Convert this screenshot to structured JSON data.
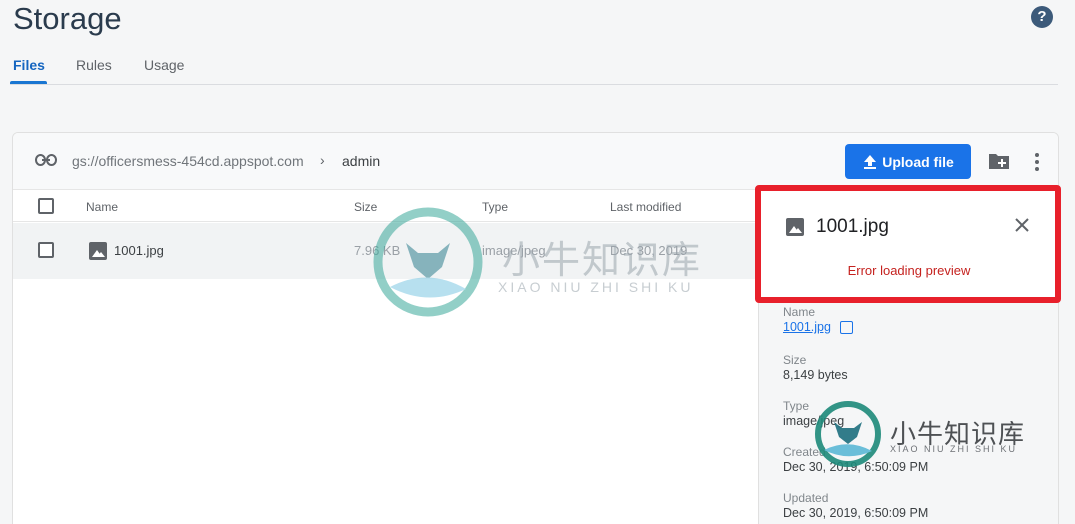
{
  "header": {
    "title": "Storage",
    "help_icon": "help-circle-icon"
  },
  "tabs": [
    {
      "label": "Files",
      "active": true
    },
    {
      "label": "Rules",
      "active": false
    },
    {
      "label": "Usage",
      "active": false
    }
  ],
  "toolbar": {
    "bucket_path": "gs://officersmess-454cd.appspot.com",
    "folder": "admin",
    "upload_label": "Upload file"
  },
  "table": {
    "columns": [
      "Name",
      "Size",
      "Type",
      "Last modified"
    ],
    "rows": [
      {
        "name": "1001.jpg",
        "size": "7.96 KB",
        "type": "image/jpeg",
        "modified": "Dec 30, 2019"
      }
    ]
  },
  "details": {
    "title": "1001.jpg",
    "error": "Error loading preview",
    "fields": [
      {
        "label": "Name",
        "value": "1001.jpg"
      },
      {
        "label": "Size",
        "value": "8,149 bytes"
      },
      {
        "label": "Type",
        "value": "image/jpeg"
      },
      {
        "label": "Created",
        "value": "Dec 30, 2019, 6:50:09 PM"
      },
      {
        "label": "Updated",
        "value": "Dec 30, 2019, 6:50:09 PM"
      }
    ]
  },
  "watermark": {
    "title": "小牛知识库",
    "subtitle": "XIAO NIU ZHI SHI KU"
  },
  "colors": {
    "primary": "#1a73e8",
    "error": "#c5221f",
    "highlight_box": "#e8202b"
  }
}
